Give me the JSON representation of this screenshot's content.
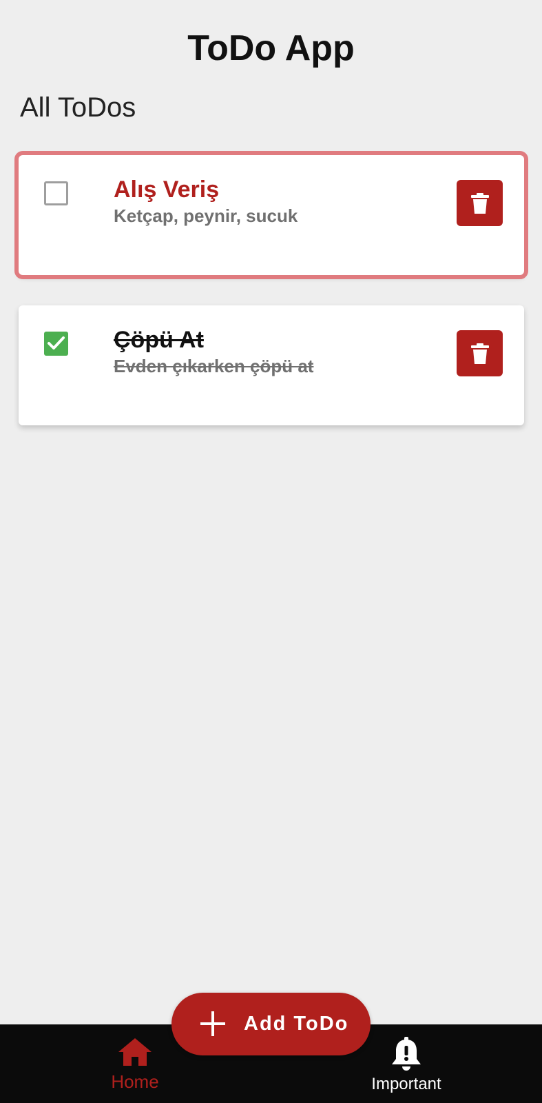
{
  "app": {
    "title": "ToDo App"
  },
  "main": {
    "section_title": "All ToDos",
    "todos": [
      {
        "title": "Alış Veriş",
        "description": "Ketçap, peynir, sucuk",
        "completed": false,
        "important": true,
        "delete_icon": "trash-icon"
      },
      {
        "title": "Çöpü At",
        "description": "Evden çıkarken çöpü at",
        "completed": true,
        "important": false,
        "delete_icon": "trash-icon"
      }
    ]
  },
  "fab": {
    "label": "Add ToDo",
    "icon": "plus-icon"
  },
  "bottom_nav": {
    "items": [
      {
        "label": "Home",
        "icon": "home-icon",
        "active": true
      },
      {
        "label": "Important",
        "icon": "bell-alert-icon",
        "active": false
      }
    ]
  },
  "colors": {
    "accent": "#b0201d",
    "important_outline": "#e07b7f",
    "checked": "#4caf50",
    "background": "#eeeeee",
    "nav_background": "#0b0b0b"
  }
}
